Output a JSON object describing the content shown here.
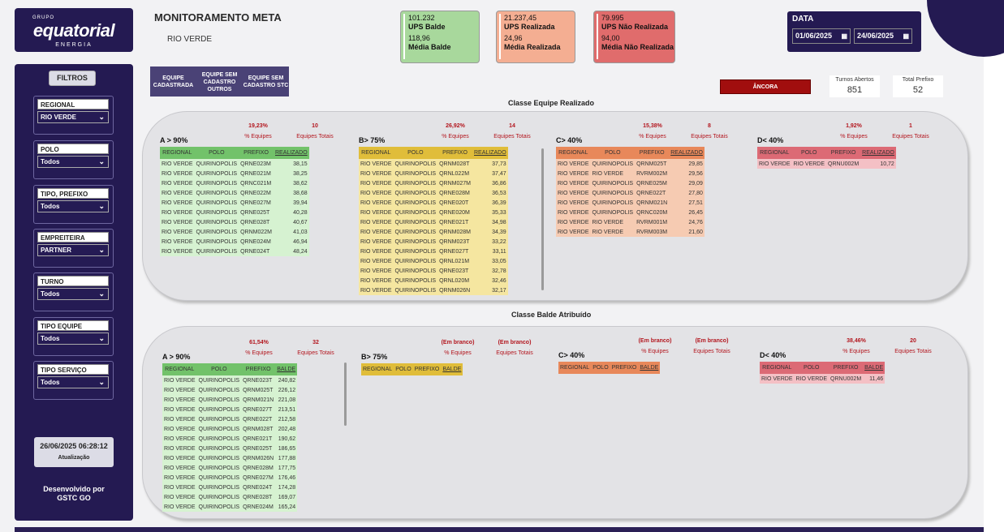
{
  "header": {
    "logo_group": "GRUPO",
    "logo_name": "equatorial",
    "logo_sub": "ENERGIA",
    "title": "MONITORAMENTO META",
    "subtitle": "RIO VERDE"
  },
  "equipe_buttons": [
    "EQUIPE CADASTRADA",
    "EQUIPE SEM CADASTRO OUTROS",
    "EQUIPE SEM CADASTRO STC"
  ],
  "kpis": [
    {
      "v1": "101.232",
      "l1": "UPS Balde",
      "v2": "118,96",
      "l2": "Média Balde",
      "color": "#a8d89c"
    },
    {
      "v1": "21.237,45",
      "l1": "UPS Realizada",
      "v2": "24,96",
      "l2": "Média Realizada",
      "color": "#f4ae92"
    },
    {
      "v1": "79.995",
      "l1": "UPS Não Realizada",
      "v2": "94,00",
      "l2": "Média Não Realizada",
      "color": "#e06c6c"
    }
  ],
  "date": {
    "label": "DATA",
    "start": "01/06/2025",
    "end": "24/06/2025"
  },
  "ancora_label": "ÂNCORA",
  "cards": [
    {
      "label": "Turnos Abertos",
      "value": "851"
    },
    {
      "label": "Total Prefixo",
      "value": "52"
    }
  ],
  "sidebar": {
    "filtros_label": "FILTROS",
    "filters": [
      {
        "label": "REGIONAL",
        "value": "RIO VERDE"
      },
      {
        "label": "POLO",
        "value": "Todos"
      },
      {
        "label": "TIPO, PREFIXO",
        "value": "Todos"
      },
      {
        "label": "EMPREITEIRA",
        "value": "PARTNER"
      },
      {
        "label": "TURNO",
        "value": "Todos"
      },
      {
        "label": "TIPO EQUIPE",
        "value": "Todos"
      },
      {
        "label": "TIPO SERVIÇO",
        "value": "Todos"
      }
    ],
    "update_time": "26/06/2025 06:28:12",
    "update_label": "Atualização",
    "dev_line1": "Desenvolvido por",
    "dev_line2": "GSTC GO"
  },
  "realizado": {
    "title": "Classe Equipe Realizado",
    "metric_label1": "% Equipes",
    "metric_label2": "Equipes Totais",
    "groups": [
      {
        "title": "A > 90%",
        "pct": "19,23%",
        "total": "10",
        "valcol": "REALIZADO",
        "rows": [
          [
            "RIO VERDE",
            "QUIRINOPOLIS",
            "QRNE023M",
            "38,15"
          ],
          [
            "RIO VERDE",
            "QUIRINOPOLIS",
            "QRNE021M",
            "38,25"
          ],
          [
            "RIO VERDE",
            "QUIRINOPOLIS",
            "QRNC021M",
            "38,62"
          ],
          [
            "RIO VERDE",
            "QUIRINOPOLIS",
            "QRNE022M",
            "38,68"
          ],
          [
            "RIO VERDE",
            "QUIRINOPOLIS",
            "QRNE027M",
            "39,94"
          ],
          [
            "RIO VERDE",
            "QUIRINOPOLIS",
            "QRNE025T",
            "40,28"
          ],
          [
            "RIO VERDE",
            "QUIRINOPOLIS",
            "QRNE028T",
            "40,67"
          ],
          [
            "RIO VERDE",
            "QUIRINOPOLIS",
            "QRNM022M",
            "41,03"
          ],
          [
            "RIO VERDE",
            "QUIRINOPOLIS",
            "QRNE024M",
            "46,94"
          ],
          [
            "RIO VERDE",
            "QUIRINOPOLIS",
            "QRNE024T",
            "48,24"
          ]
        ]
      },
      {
        "title": "B> 75%",
        "pct": "26,92%",
        "total": "14",
        "valcol": "REALIZADO",
        "rows": [
          [
            "RIO VERDE",
            "QUIRINOPOLIS",
            "QRNM028T",
            "37,73"
          ],
          [
            "RIO VERDE",
            "QUIRINOPOLIS",
            "QRNL022M",
            "37,47"
          ],
          [
            "RIO VERDE",
            "QUIRINOPOLIS",
            "QRNM027M",
            "36,86"
          ],
          [
            "RIO VERDE",
            "QUIRINOPOLIS",
            "QRNE028M",
            "36,53"
          ],
          [
            "RIO VERDE",
            "QUIRINOPOLIS",
            "QRNE020T",
            "36,39"
          ],
          [
            "RIO VERDE",
            "QUIRINOPOLIS",
            "QRNE020M",
            "35,33"
          ],
          [
            "RIO VERDE",
            "QUIRINOPOLIS",
            "QRNE021T",
            "34,98"
          ],
          [
            "RIO VERDE",
            "QUIRINOPOLIS",
            "QRNM028M",
            "34,39"
          ],
          [
            "RIO VERDE",
            "QUIRINOPOLIS",
            "QRNM023T",
            "33,22"
          ],
          [
            "RIO VERDE",
            "QUIRINOPOLIS",
            "QRNE027T",
            "33,11"
          ],
          [
            "RIO VERDE",
            "QUIRINOPOLIS",
            "QRNL021M",
            "33,05"
          ],
          [
            "RIO VERDE",
            "QUIRINOPOLIS",
            "QRNE023T",
            "32,78"
          ],
          [
            "RIO VERDE",
            "QUIRINOPOLIS",
            "QRNL020M",
            "32,46"
          ],
          [
            "RIO VERDE",
            "QUIRINOPOLIS",
            "QRNM026N",
            "32,17"
          ]
        ]
      },
      {
        "title": "C> 40%",
        "pct": "15,38%",
        "total": "8",
        "valcol": "REALIZADO",
        "rows": [
          [
            "RIO VERDE",
            "QUIRINOPOLIS",
            "QRNM025T",
            "29,85"
          ],
          [
            "RIO VERDE",
            "RIO VERDE",
            "RVRM002M",
            "29,56"
          ],
          [
            "RIO VERDE",
            "QUIRINOPOLIS",
            "QRNE025M",
            "29,09"
          ],
          [
            "RIO VERDE",
            "QUIRINOPOLIS",
            "QRNE022T",
            "27,80"
          ],
          [
            "RIO VERDE",
            "QUIRINOPOLIS",
            "QRNM021N",
            "27,51"
          ],
          [
            "RIO VERDE",
            "QUIRINOPOLIS",
            "QRNC020M",
            "26,45"
          ],
          [
            "RIO VERDE",
            "RIO VERDE",
            "RVRM001M",
            "24,76"
          ],
          [
            "RIO VERDE",
            "RIO VERDE",
            "RVRM003M",
            "21,60"
          ]
        ]
      },
      {
        "title": "D< 40%",
        "pct": "1,92%",
        "total": "1",
        "valcol": "REALIZADO",
        "rows": [
          [
            "RIO VERDE",
            "RIO VERDE",
            "QRNU002M",
            "10,72"
          ]
        ]
      }
    ]
  },
  "balde": {
    "title": "Classe Balde Atribuído",
    "metric_label1": "% Equipes",
    "metric_label2": "Equipes Totais",
    "groups": [
      {
        "title": "A > 90%",
        "pct": "61,54%",
        "total": "32",
        "valcol": "BALDE",
        "rows": [
          [
            "RIO VERDE",
            "QUIRINOPOLIS",
            "QRNE023T",
            "240,82"
          ],
          [
            "RIO VERDE",
            "QUIRINOPOLIS",
            "QRNM025T",
            "226,12"
          ],
          [
            "RIO VERDE",
            "QUIRINOPOLIS",
            "QRNM021N",
            "221,08"
          ],
          [
            "RIO VERDE",
            "QUIRINOPOLIS",
            "QRNE027T",
            "213,51"
          ],
          [
            "RIO VERDE",
            "QUIRINOPOLIS",
            "QRNE022T",
            "212,58"
          ],
          [
            "RIO VERDE",
            "QUIRINOPOLIS",
            "QRNM028T",
            "202,48"
          ],
          [
            "RIO VERDE",
            "QUIRINOPOLIS",
            "QRNE021T",
            "190,62"
          ],
          [
            "RIO VERDE",
            "QUIRINOPOLIS",
            "QRNE025T",
            "186,65"
          ],
          [
            "RIO VERDE",
            "QUIRINOPOLIS",
            "QRNM026N",
            "177,88"
          ],
          [
            "RIO VERDE",
            "QUIRINOPOLIS",
            "QRNE028M",
            "177,75"
          ],
          [
            "RIO VERDE",
            "QUIRINOPOLIS",
            "QRNE027M",
            "176,46"
          ],
          [
            "RIO VERDE",
            "QUIRINOPOLIS",
            "QRNE024T",
            "174,28"
          ],
          [
            "RIO VERDE",
            "QUIRINOPOLIS",
            "QRNE028T",
            "169,07"
          ],
          [
            "RIO VERDE",
            "QUIRINOPOLIS",
            "QRNE024M",
            "165,24"
          ]
        ]
      },
      {
        "title": "B> 75%",
        "pct": "(Em branco)",
        "total": "(Em branco)",
        "valcol": "BALDE",
        "rows": []
      },
      {
        "title": "C> 40%",
        "pct": "(Em branco)",
        "total": "(Em branco)",
        "valcol": "BALDE",
        "rows": []
      },
      {
        "title": "D< 40%",
        "pct": "38,46%",
        "total": "20",
        "valcol": "BALDE",
        "rows": [
          [
            "RIO VERDE",
            "RIO VERDE",
            "QRNU002M",
            "11,46"
          ]
        ]
      }
    ]
  },
  "columns": [
    "REGIONAL",
    "POLO",
    "PREFIXO"
  ]
}
